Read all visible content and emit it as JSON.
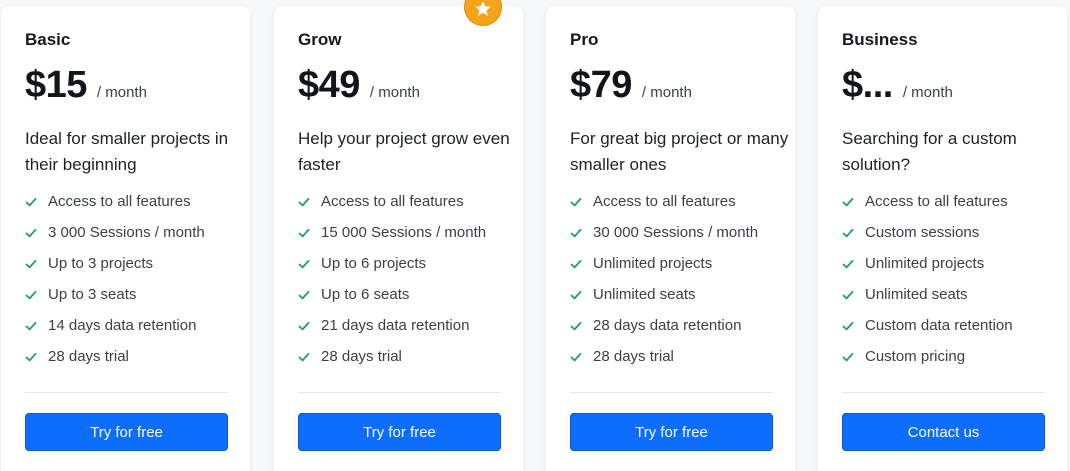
{
  "accent_color": "#0d6efd",
  "check_color": "#1e9e6a",
  "badge_color": "#f6a21a",
  "featured_badge_icon": "star-icon",
  "plans": [
    {
      "name": "Basic",
      "price": "$15",
      "period": "/ month",
      "description": "Ideal for smaller projects in their beginning",
      "features": [
        "Access to all features",
        "3 000 Sessions / month",
        "Up to 3 projects",
        "Up to 3 seats",
        "14 days data retention",
        "28 days trial"
      ],
      "cta": "Try for free"
    },
    {
      "name": "Grow",
      "price": "$49",
      "period": "/ month",
      "description": "Help your project grow even faster",
      "features": [
        "Access to all features",
        "15 000 Sessions / month",
        "Up to 6 projects",
        "Up to 6 seats",
        "21 days data retention",
        "28 days trial"
      ],
      "cta": "Try for free"
    },
    {
      "name": "Pro",
      "price": "$79",
      "period": "/ month",
      "description": "For great big project or many smaller ones",
      "features": [
        "Access to all features",
        "30 000 Sessions / month",
        "Unlimited projects",
        "Unlimited seats",
        "28 days data retention",
        "28 days trial"
      ],
      "cta": "Try for free"
    },
    {
      "name": "Business",
      "price": "$...",
      "period": "/ month",
      "description": "Searching for a custom solution?",
      "features": [
        "Access to all features",
        "Custom sessions",
        "Unlimited projects",
        "Unlimited seats",
        "Custom data retention",
        "Custom pricing"
      ],
      "cta": "Contact us"
    }
  ]
}
